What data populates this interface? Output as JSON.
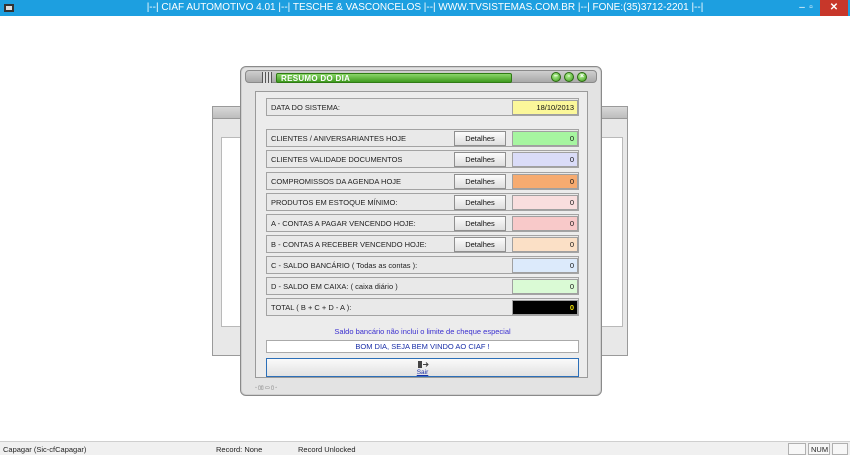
{
  "window": {
    "title": "|--| CIAF AUTOMOTIVO 4.01 |--| TESCHE & VASCONCELOS |--| WWW.TVSISTEMAS.COM.BR |--| FONE:(35)3712-2201 |--|",
    "minimize_glyph": "–",
    "maximize_glyph": "▫",
    "close_glyph": "✕"
  },
  "dialog": {
    "title": "RESUMO DO DIA",
    "system_date_label": "DATA DO SISTEMA:",
    "system_date": "18/10/2013",
    "rows": [
      {
        "label": "CLIENTES / ANIVERSARIANTES HOJE",
        "details": "Detalhes",
        "value": "0",
        "color": "#a6f5a0"
      },
      {
        "label": "CLIENTES VALIDADE DOCUMENTOS",
        "details": "Detalhes",
        "value": "0",
        "color": "#dadcf8"
      },
      {
        "label": "COMPROMISSOS DA AGENDA HOJE",
        "details": "Detalhes",
        "value": "0",
        "color": "#f6ab70"
      },
      {
        "label": "PRODUTOS EM ESTOQUE MÍNIMO:",
        "details": "Detalhes",
        "value": "0",
        "color": "#f9dede"
      },
      {
        "label": "A - CONTAS A PAGAR VENCENDO HOJE:",
        "details": "Detalhes",
        "value": "0",
        "color": "#f8c9c9"
      },
      {
        "label": "B - CONTAS A RECEBER VENCENDO HOJE:",
        "details": "Detalhes",
        "value": "0",
        "color": "#fbe0c6"
      },
      {
        "label": "C - SALDO BANCÁRIO ( Todas as contas ):",
        "value": "0",
        "color": "#dceafb"
      },
      {
        "label": "D - SALDO EM CAIXA: ( caixa diário )",
        "value": "0",
        "color": "#dafad5"
      },
      {
        "label": "TOTAL ( B + C + D - A ):",
        "value": "0",
        "color": "#000000"
      }
    ],
    "note": "Saldo bancário não inclui o limite de cheque especial",
    "welcome": "BOM DIA, SEJA BEM VINDO AO CIAF !",
    "exit_label": "Sair"
  },
  "status_bar": {
    "left": "Capagar (Sic-cfCapagar)",
    "record": "Record: None",
    "lock": "Record Unlocked",
    "num": "NUM"
  }
}
